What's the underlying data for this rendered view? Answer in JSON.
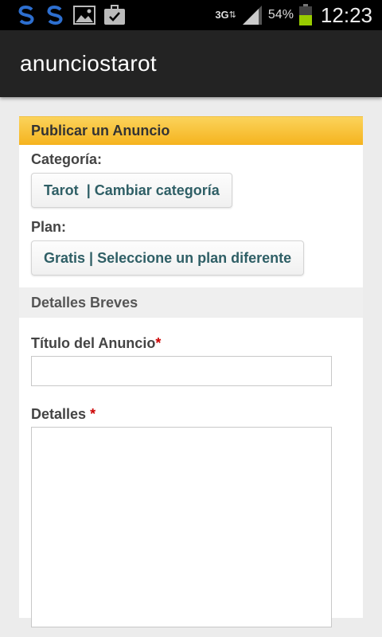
{
  "status_bar": {
    "network_type": "3G",
    "battery_percent": "54%",
    "time": "12:23",
    "left_icons": [
      "link-icon",
      "link-icon",
      "image-icon",
      "briefcase-check-icon"
    ],
    "right_icons": [
      "data-arrows-icon",
      "signal-icon",
      "battery-icon"
    ],
    "battery_color": "#99cc00"
  },
  "action_bar": {
    "title": "anunciostarot"
  },
  "form": {
    "header": "Publicar un Anuncio",
    "category": {
      "label": "Categoría:",
      "value": "Tarot",
      "change_link": "| Cambiar categoría"
    },
    "plan": {
      "label": "Plan:",
      "value": "Gratis",
      "change_link": "| Seleccione un plan diferente"
    },
    "details_section": "Detalles Breves",
    "title_field": {
      "label": "Título del Anuncio",
      "required_mark": "*",
      "value": "",
      "placeholder": ""
    },
    "details_field": {
      "label": "Detalles",
      "required_mark": "*",
      "value": "",
      "placeholder": ""
    }
  },
  "colors": {
    "header_yellow": "#f5b31e",
    "link_teal": "#2f5f66",
    "required_red": "#cc0000",
    "action_bar": "#232323"
  }
}
